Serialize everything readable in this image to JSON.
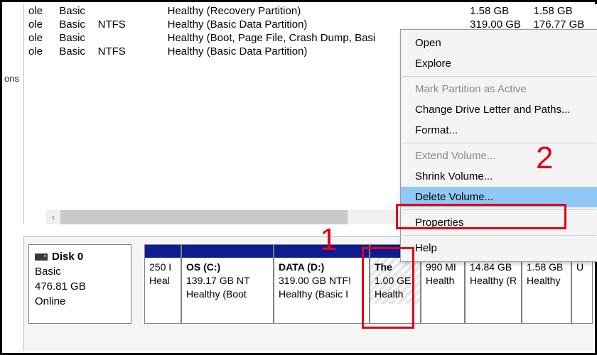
{
  "sidebar_fragment": "ons",
  "volume_rows": [
    {
      "layout": "ole",
      "type": "Basic",
      "fs": "",
      "status": "Healthy (Recovery Partition)",
      "cap": "1.58 GB",
      "free": "1.58 GB"
    },
    {
      "layout": "ole",
      "type": "Basic",
      "fs": "NTFS",
      "status": "Healthy (Basic Data Partition)",
      "cap": "319.00 GB",
      "free": "176.77 GB"
    },
    {
      "layout": "ole",
      "type": "Basic",
      "fs": "",
      "status": "Healthy (Boot, Page File, Crash Dump, Basi",
      "cap": "",
      "free": ""
    },
    {
      "layout": "ole",
      "type": "Basic",
      "fs": "NTFS",
      "status": "Healthy (Basic Data Partition)",
      "cap": "",
      "free": ""
    }
  ],
  "disk": {
    "title": "Disk 0",
    "type": "Basic",
    "size": "476.81 GB",
    "state": "Online"
  },
  "partitions": [
    {
      "label": "",
      "size": "250 I",
      "status": "Heal"
    },
    {
      "label": "OS  (C:)",
      "size": "139.17 GB NT",
      "status": "Healthy (Boot"
    },
    {
      "label": "DATA  (D:)",
      "size": "319.00 GB NTF!",
      "status": "Healthy (Basic I"
    },
    {
      "label": "The",
      "size": "1.00 GE",
      "status": "Health"
    },
    {
      "label": "",
      "size": "990 MI",
      "status": "Health"
    },
    {
      "label": "",
      "size": "14.84 GB",
      "status": "Healthy (R"
    },
    {
      "label": "",
      "size": "1.58 GB",
      "status": "Healthy"
    },
    {
      "label": "",
      "size": "",
      "status": "U"
    }
  ],
  "context_menu": {
    "open": "Open",
    "explore": "Explore",
    "mark_active": "Mark Partition as Active",
    "change_letter": "Change Drive Letter and Paths...",
    "format": "Format...",
    "extend": "Extend Volume...",
    "shrink": "Shrink Volume...",
    "delete": "Delete Volume...",
    "properties": "Properties",
    "help": "Help"
  },
  "annotations": {
    "one": "1",
    "two": "2"
  }
}
